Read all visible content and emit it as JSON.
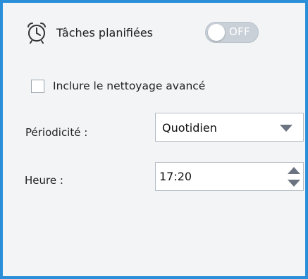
{
  "schedule": {
    "title": "Tâches planifiées",
    "toggle_label": "OFF",
    "toggle_on": false,
    "icon": "alarm-clock-icon"
  },
  "advanced": {
    "label": "Inclure le nettoyage avancé",
    "checked": false
  },
  "frequency": {
    "label": "Périodicité :",
    "value": "Quotidien"
  },
  "time": {
    "label": "Heure :",
    "value": "17:20"
  },
  "colors": {
    "accent_border": "#2a8fd8",
    "panel_bg": "#f2f4f6",
    "toggle_off": "#c9d0d8"
  }
}
